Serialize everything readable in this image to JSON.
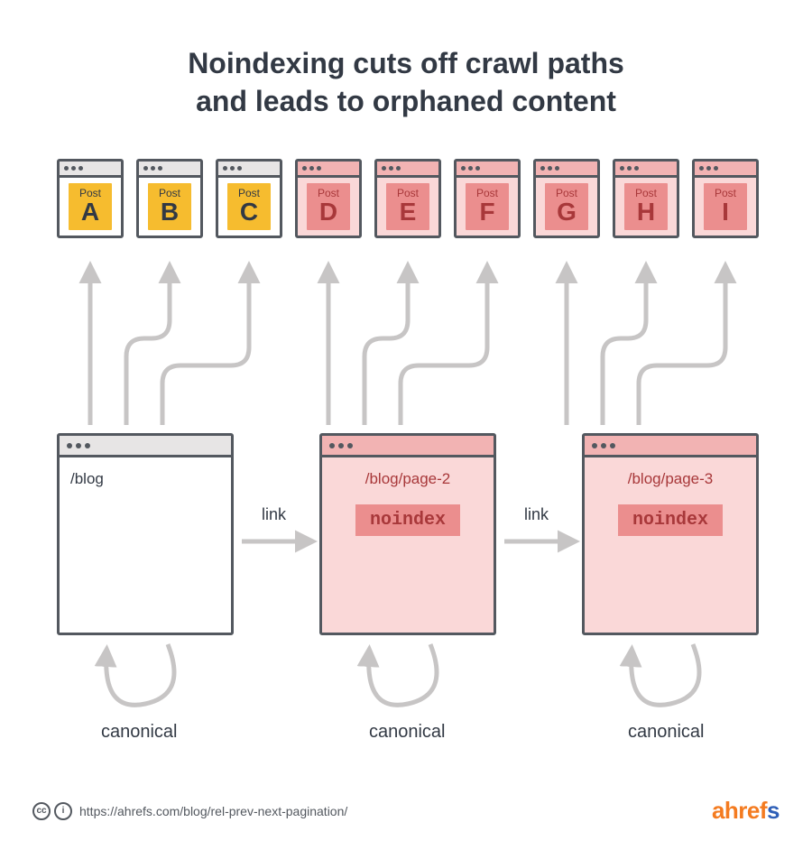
{
  "title_line1": "Noindexing cuts off crawl paths",
  "title_line2": "and leads to orphaned content",
  "post_label": "Post",
  "posts": {
    "a": "A",
    "b": "B",
    "c": "C",
    "d": "D",
    "e": "E",
    "f": "F",
    "g": "G",
    "h": "H",
    "i": "I"
  },
  "pages": {
    "page1": {
      "url": "/blog"
    },
    "page2": {
      "url": "/blog/page-2",
      "badge": "noindex"
    },
    "page3": {
      "url": "/blog/page-3",
      "badge": "noindex"
    }
  },
  "link_label": "link",
  "canonical_label": "canonical",
  "footer": {
    "cc": "cc",
    "by": "i",
    "url": "https://ahrefs.com/blog/rel-prev-next-pagination/",
    "logo_prefix": "ahrefs"
  }
}
